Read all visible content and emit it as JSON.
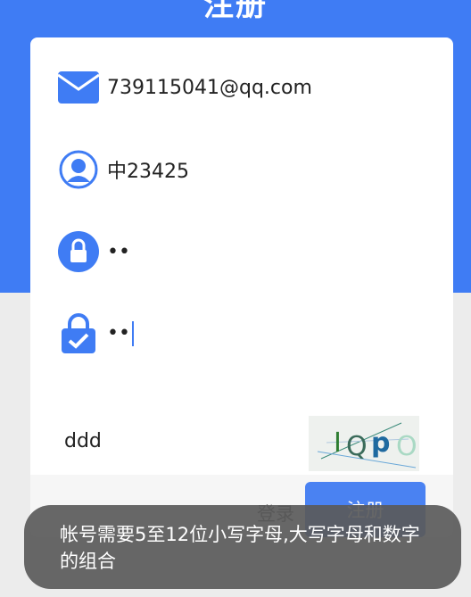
{
  "header": {
    "title": "注册"
  },
  "form": {
    "email": {
      "icon": "mail-icon",
      "value": "739115041@qq.com"
    },
    "username": {
      "icon": "user-icon",
      "value": "中23425"
    },
    "password": {
      "icon": "lock-icon",
      "value": "••"
    },
    "confirm_password": {
      "icon": "lock-check-icon",
      "value": "••"
    },
    "captcha": {
      "value": "ddd",
      "image_text": "IQpO"
    }
  },
  "actions": {
    "login_label": "登录",
    "register_label": "注册"
  },
  "toast": {
    "message": "帐号需要5至12位小写字母,大写字母和数字的组合"
  },
  "colors": {
    "accent": "#3f7cf4",
    "background": "#ececec",
    "toast_bg": "#5a5a5a"
  }
}
